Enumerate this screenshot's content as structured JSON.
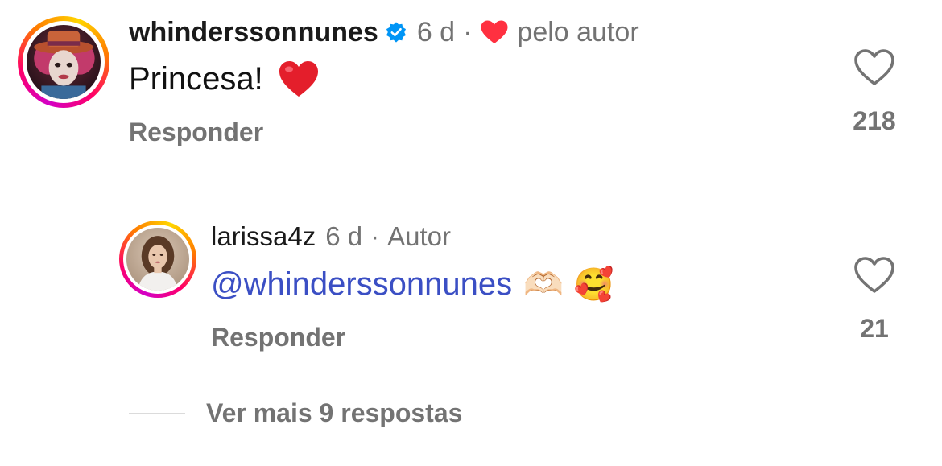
{
  "comment": {
    "username": "whinderssonnunes",
    "verified": true,
    "time": "6 d",
    "separator": "·",
    "liked_by_author_label": "pelo autor",
    "text": "Princesa!",
    "emoji": "❤️",
    "reply_label": "Responder",
    "like_count": "218",
    "avatar_icon": "user-avatar-icon",
    "heart_icon": "heart-outline-icon"
  },
  "reply": {
    "username": "larissa4z",
    "time": "6 d",
    "separator": "·",
    "author_label": "Autor",
    "mention": "@whinderssonnunes",
    "emojis": "🫶🏻 🥰",
    "reply_label": "Responder",
    "like_count": "21",
    "avatar_icon": "user-avatar-icon",
    "heart_icon": "heart-outline-icon"
  },
  "more_replies_label": "Ver mais 9 respostas",
  "colors": {
    "mention": "#3b4fc4",
    "meta": "#737373",
    "verified": "#0095f6",
    "like_heart": "#ff3040"
  }
}
